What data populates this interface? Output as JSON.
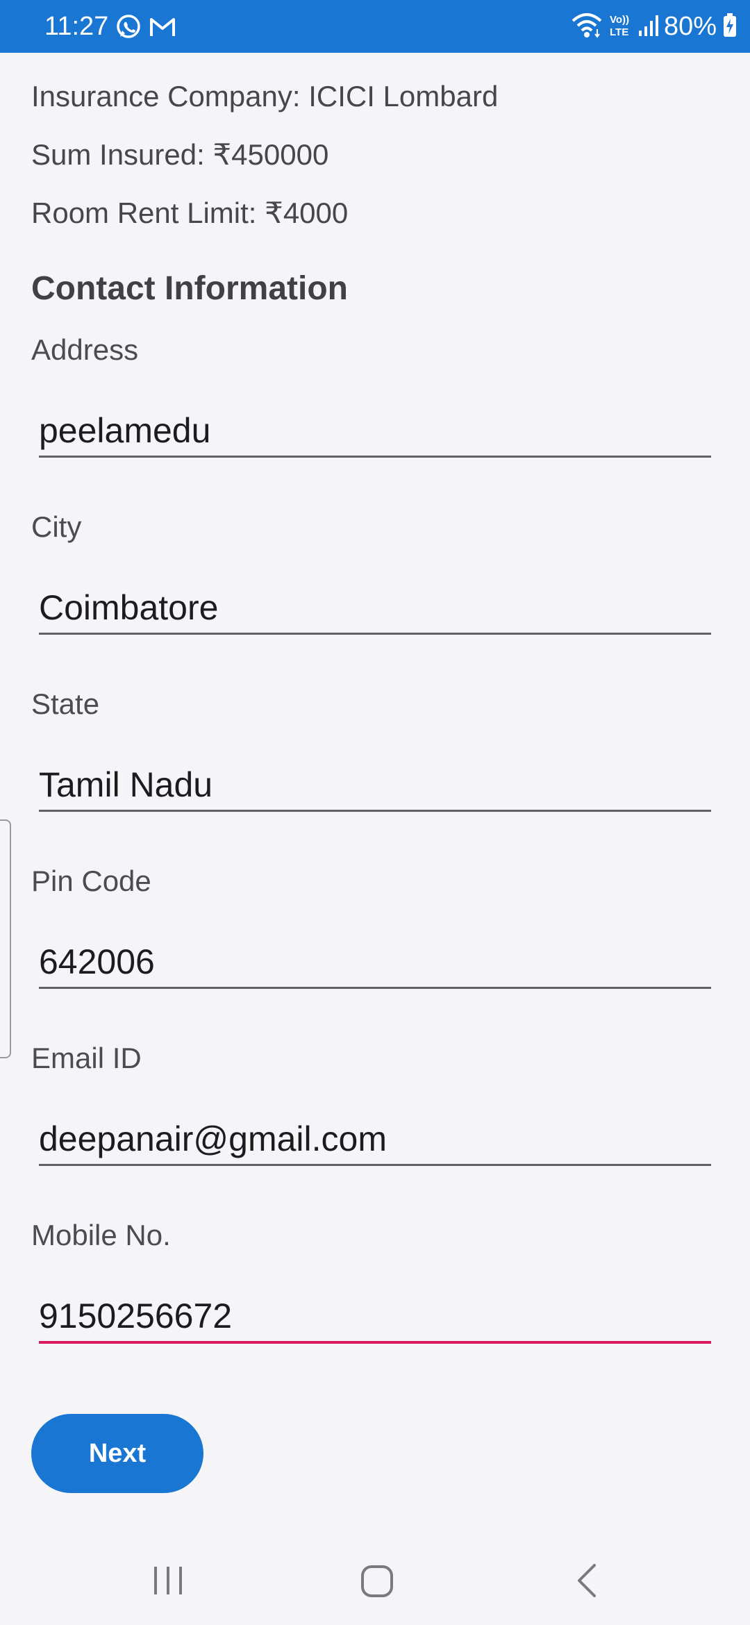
{
  "status_bar": {
    "time": "11:27",
    "battery": "80%",
    "icons": [
      "whatsapp-icon",
      "gmail-icon",
      "wifi-icon",
      "volte-icon",
      "signal-icon",
      "battery-charging-icon"
    ],
    "background_color": "#1976d2"
  },
  "policy": {
    "insurance_company": "Insurance Company: ICICI Lombard",
    "sum_insured": "Sum Insured: ₹450000",
    "room_rent_limit": "Room Rent Limit: ₹4000"
  },
  "contact": {
    "title": "Contact Information",
    "address": {
      "label": "Address",
      "value": "peelamedu"
    },
    "city": {
      "label": "City",
      "value": "Coimbatore"
    },
    "state": {
      "label": "State",
      "value": "Tamil Nadu"
    },
    "pin_code": {
      "label": "Pin Code",
      "value": "642006"
    },
    "email": {
      "label": "Email ID",
      "value": "deepanair@gmail.com"
    },
    "mobile": {
      "label": "Mobile No.",
      "value": "9150256672"
    }
  },
  "actions": {
    "next_label": "Next"
  },
  "navigation": {
    "icons": [
      "recent-apps-icon",
      "home-icon",
      "back-icon"
    ]
  },
  "colors": {
    "accent": "#1976d2",
    "focus_underline": "#d81b60",
    "background": "#f5f5f7"
  }
}
